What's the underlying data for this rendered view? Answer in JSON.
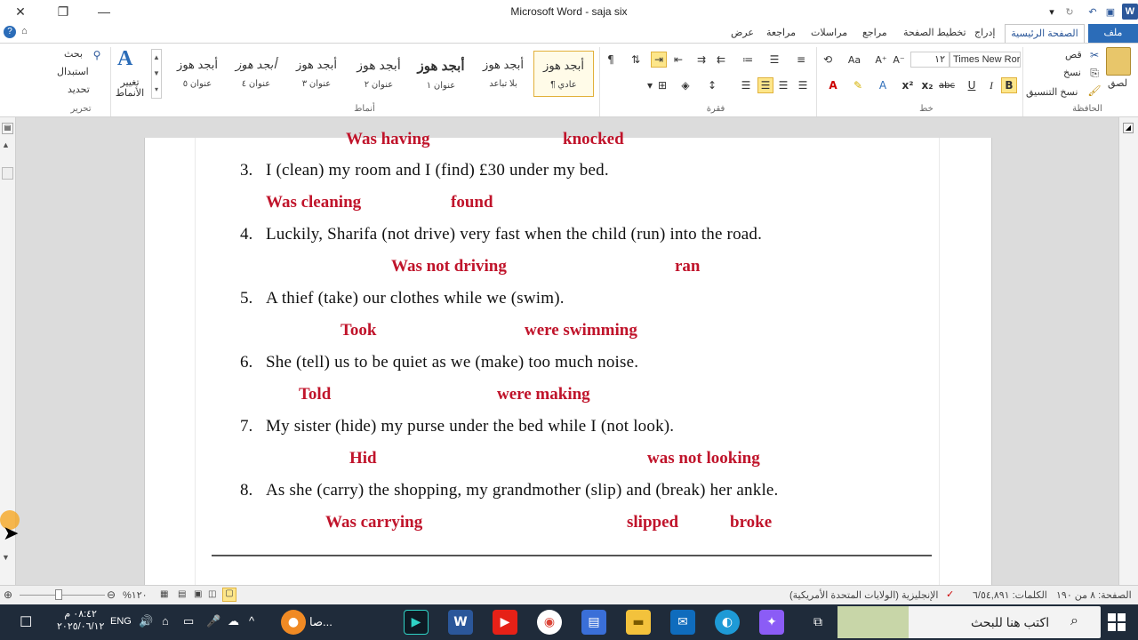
{
  "window": {
    "title": "Microsoft Word - saja six"
  },
  "titlebar": {
    "close": "✕",
    "restore": "❐",
    "minimize": "—"
  },
  "tabs": [
    {
      "id": "file",
      "label": "ملف"
    },
    {
      "id": "home",
      "label": "الصفحة الرئيسية"
    },
    {
      "id": "insert",
      "label": "إدراج"
    },
    {
      "id": "layout",
      "label": "تخطيط الصفحة"
    },
    {
      "id": "refs",
      "label": "مراجع"
    },
    {
      "id": "mail",
      "label": "مراسلات"
    },
    {
      "id": "review",
      "label": "مراجعة"
    },
    {
      "id": "view",
      "label": "عرض"
    }
  ],
  "ribbon": {
    "clipboard": {
      "group": "الحافظة",
      "paste": "لصق",
      "cut": "قص",
      "copy": "نسخ",
      "format_painter": "نسخ التنسيق"
    },
    "font": {
      "group": "خط",
      "name": "Times New Ror",
      "size": "١٢"
    },
    "paragraph": {
      "group": "فقرة"
    },
    "styles": {
      "group": "أنماط",
      "change": "تغيير الأنماط",
      "preview": "أبجد هوز",
      "items": [
        "¶ عادي",
        "بلا تباعد",
        "عنوان ١",
        "عنوان ٢",
        "عنوان ٣",
        "عنوان ٤",
        "عنوان ٥"
      ]
    },
    "editing": {
      "group": "تحرير",
      "find": "بحث",
      "replace": "استبدال",
      "select": "تحديد"
    }
  },
  "document": {
    "partial_top": {
      "a1": "Was having",
      "a2": "knocked"
    },
    "items": [
      {
        "num": "3.",
        "text": "I (clean) my room  and I (find)  £30 under my bed.",
        "a1": "Was cleaning",
        "a2": "found"
      },
      {
        "num": "4.",
        "text": "Luckily,  Sharifa  (not drive)  very  fast when the child  (run)  into the road.",
        "a1": "Was not driving",
        "a2": "ran"
      },
      {
        "num": "5.",
        "text": "A thief (take)  our  clothes  while  we  (swim).",
        "a1": "Took",
        "a2": "were swimming"
      },
      {
        "num": "6.",
        "text": "She (tell) us to be quiet as we (make)  too much  noise.",
        "a1": "Told",
        "a2": "were making"
      },
      {
        "num": "7.",
        "text": "My sister  (hide)  my purse  under  the bed while  I (not  look).",
        "a1": "Hid",
        "a2": "was not looking"
      },
      {
        "num": "8.",
        "text": "As she (carry)  the shopping,  my grandmother  (slip)  and  (break)  her ankle.",
        "a1": "Was carrying",
        "a2": "slipped",
        "a3": "broke"
      }
    ]
  },
  "status": {
    "page": "الصفحة: ٨ من ١٩٠",
    "words": "الكلمات: ٦/٥٤,٨٩١",
    "language": "الإنجليزية (الولايات المتحدة الأمريكية)",
    "zoom": "%١٢٠"
  },
  "taskbar": {
    "search_placeholder": "اكتب هنا للبحث",
    "time": "٠٨:٤٢ م",
    "date": "٢٠٢٥/٠٦/١٢",
    "lang": "ENG",
    "app_label": "صا..."
  }
}
